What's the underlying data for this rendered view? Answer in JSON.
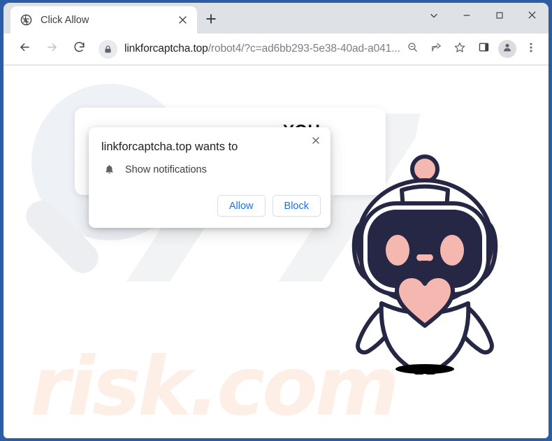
{
  "browser": {
    "tab": {
      "title": "Click Allow",
      "favicon_icon": "globe-icon",
      "close_icon": "close-icon"
    },
    "new_tab_icon": "plus-icon",
    "window_controls": [
      {
        "name": "tab-search-button",
        "icon": "chevron-down-icon"
      },
      {
        "name": "minimize-button",
        "icon": "minimize-icon"
      },
      {
        "name": "maximize-button",
        "icon": "maximize-icon"
      },
      {
        "name": "close-window-button",
        "icon": "close-icon"
      }
    ],
    "nav": {
      "back_icon": "back-arrow-icon",
      "forward_icon": "forward-arrow-icon",
      "reload_icon": "reload-icon"
    },
    "omnibox": {
      "lock_icon": "lock-icon",
      "url_host": "linkforcaptcha.top",
      "url_path": "/robot4/?c=ad6bb293-5e38-40ad-a041...",
      "url_full": "linkforcaptcha.top/robot4/?c=ad6bb293-5e38-40ad-a041..."
    },
    "toolbar_icons": [
      {
        "name": "zoom-out-icon",
        "icon": "search-minus-icon"
      },
      {
        "name": "share-icon",
        "icon": "share-icon"
      },
      {
        "name": "bookmark-star-icon",
        "icon": "star-icon"
      },
      {
        "name": "side-panel-icon",
        "icon": "side-panel-icon"
      },
      {
        "name": "profile-avatar",
        "icon": "person-icon"
      },
      {
        "name": "chrome-menu-button",
        "icon": "three-dot-menu-icon"
      }
    ]
  },
  "permission_dialog": {
    "title": "linkforcaptcha.top wants to",
    "permission_icon": "bell-icon",
    "permission_label": "Show notifications",
    "allow_label": "Allow",
    "block_label": "Block",
    "close_icon": "close-icon"
  },
  "page": {
    "headline_visible_text": "YOU",
    "robot_icon": "robot-mascot-icon",
    "watermark_text": "risk.com",
    "watermark_logo_icon": "magnifier-icon"
  },
  "colors": {
    "window_border": "#2c5ca4",
    "tabstrip": "#dee1e6",
    "link_blue": "#1a73e8",
    "robot_outline": "#252744",
    "robot_pink": "#f4b8b0",
    "watermark_pink": "#fdeee6",
    "watermark_gray": "#f2f3f5"
  }
}
